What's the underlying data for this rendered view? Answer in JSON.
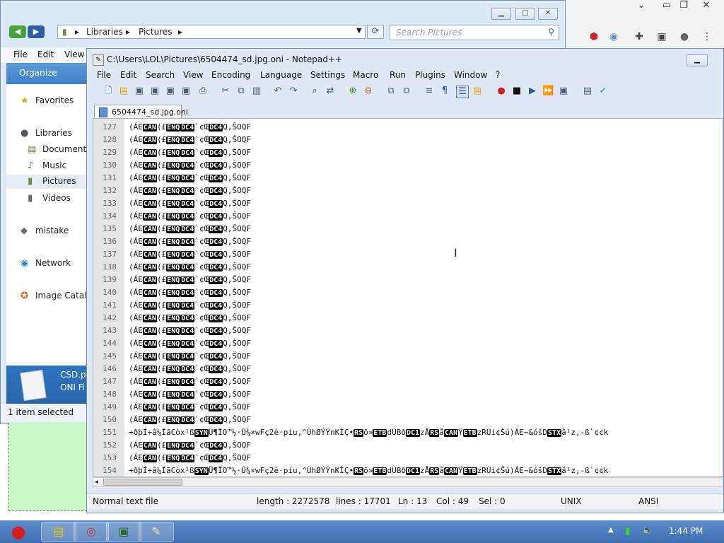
{
  "explorer": {
    "breadcrumb": [
      "Libraries",
      "Pictures"
    ],
    "search_placeholder": "Search Pictures",
    "menu": [
      "File",
      "Edit",
      "View"
    ],
    "organize_label": "Organize",
    "nav": {
      "favorites": "Favorites",
      "libraries": "Libraries",
      "documents": "Documents",
      "music": "Music",
      "pictures": "Pictures",
      "videos": "Videos",
      "mistake": "mistake",
      "network": "Network",
      "image_catalog": "Image Catalo"
    },
    "details_name": "CSD.p",
    "details_type": "ONI Fi",
    "status": "1 item selected"
  },
  "npp": {
    "title": "C:\\Users\\LOL\\Pictures\\6504474_sd.jpg.oni - Notepad++",
    "menu": [
      "File",
      "Edit",
      "Search",
      "View",
      "Encoding",
      "Language",
      "Settings",
      "Macro",
      "Run",
      "Plugins",
      "Window",
      "?"
    ],
    "tab_label": "6504474_sd.jpg.oni",
    "lines": {
      "numbers": [
        "127",
        "128",
        "129",
        "130",
        "131",
        "132",
        "133",
        "134",
        "135",
        "136",
        "137",
        "138",
        "139",
        "140",
        "141",
        "142",
        "143",
        "144",
        "145",
        "146",
        "147",
        "148",
        "149",
        "150",
        "151",
        "152",
        "153",
        "154"
      ],
      "repeat_pre": "(ÁE",
      "repeat_tok1": "CAN",
      "repeat_mid1": "(£",
      "repeat_tok2": "ENQ",
      "repeat_tok3": "DC4",
      "repeat_mid2": "`¢Œ",
      "repeat_tok4": "DC4",
      "repeat_post": "Q,ŠOQF",
      "long_1": "+ðþÍ÷â¼ÏãCòx¹ß",
      "long_tok1": "SYN",
      "long_2": "Ü¶ÏO™½·Ú¾×wFç2è·píu,^ÙhØÝÝnKÌÇ•",
      "long_tok2": "RS",
      "long_3": "õ»",
      "long_tok3": "ETB",
      "long_4": "dÚBð",
      "long_tok4": "DC1",
      "long_5": "zÅ",
      "long_tok5": "RS",
      "long_6": "å",
      "long_tok6": "CAN",
      "long_7": "Ÿ",
      "long_tok7": "ETB",
      "long_8": "zRÚi¢Šú)ÁE~&óšD",
      "long_tok8": "STX",
      "long_9": "â¹z,-ß`¢¢k"
    },
    "status": {
      "type": "Normal text file",
      "length": "length : 2272578",
      "lines": "lines : 17701",
      "ln": "Ln : 13",
      "col": "Col : 49",
      "sel": "Sel : 0",
      "eol": "UNIX",
      "encoding": "ANSI"
    }
  },
  "taskbar": {
    "clock": "1:44 PM"
  }
}
